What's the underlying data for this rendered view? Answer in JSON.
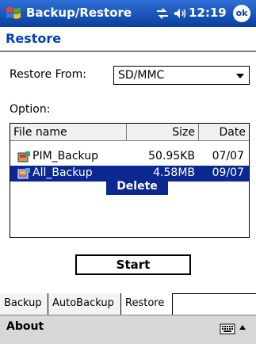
{
  "titlebar": {
    "app_title": "Backup/Restore",
    "clock": "12:19",
    "ok_label": "ok"
  },
  "page": {
    "title": "Restore"
  },
  "form": {
    "restore_from_label": "Restore From:",
    "restore_from_value": "SD/MMC",
    "option_label": "Option:"
  },
  "list": {
    "columns": [
      "File name",
      "Size",
      "Date"
    ],
    "rows": [
      {
        "name": "PIM_Backup",
        "size": "50.95KB",
        "date": "07/07"
      },
      {
        "name": "All_Backup",
        "size": "4.58MB",
        "date": "09/07"
      }
    ]
  },
  "context_menu": {
    "delete": "Delete"
  },
  "start_button": "Start",
  "tabs": [
    "Backup",
    "AutoBackup",
    "Restore"
  ],
  "cmdbar": {
    "about": "About"
  },
  "colors": {
    "title_blue": "#0a3fb0",
    "selection": "#0a2890"
  }
}
